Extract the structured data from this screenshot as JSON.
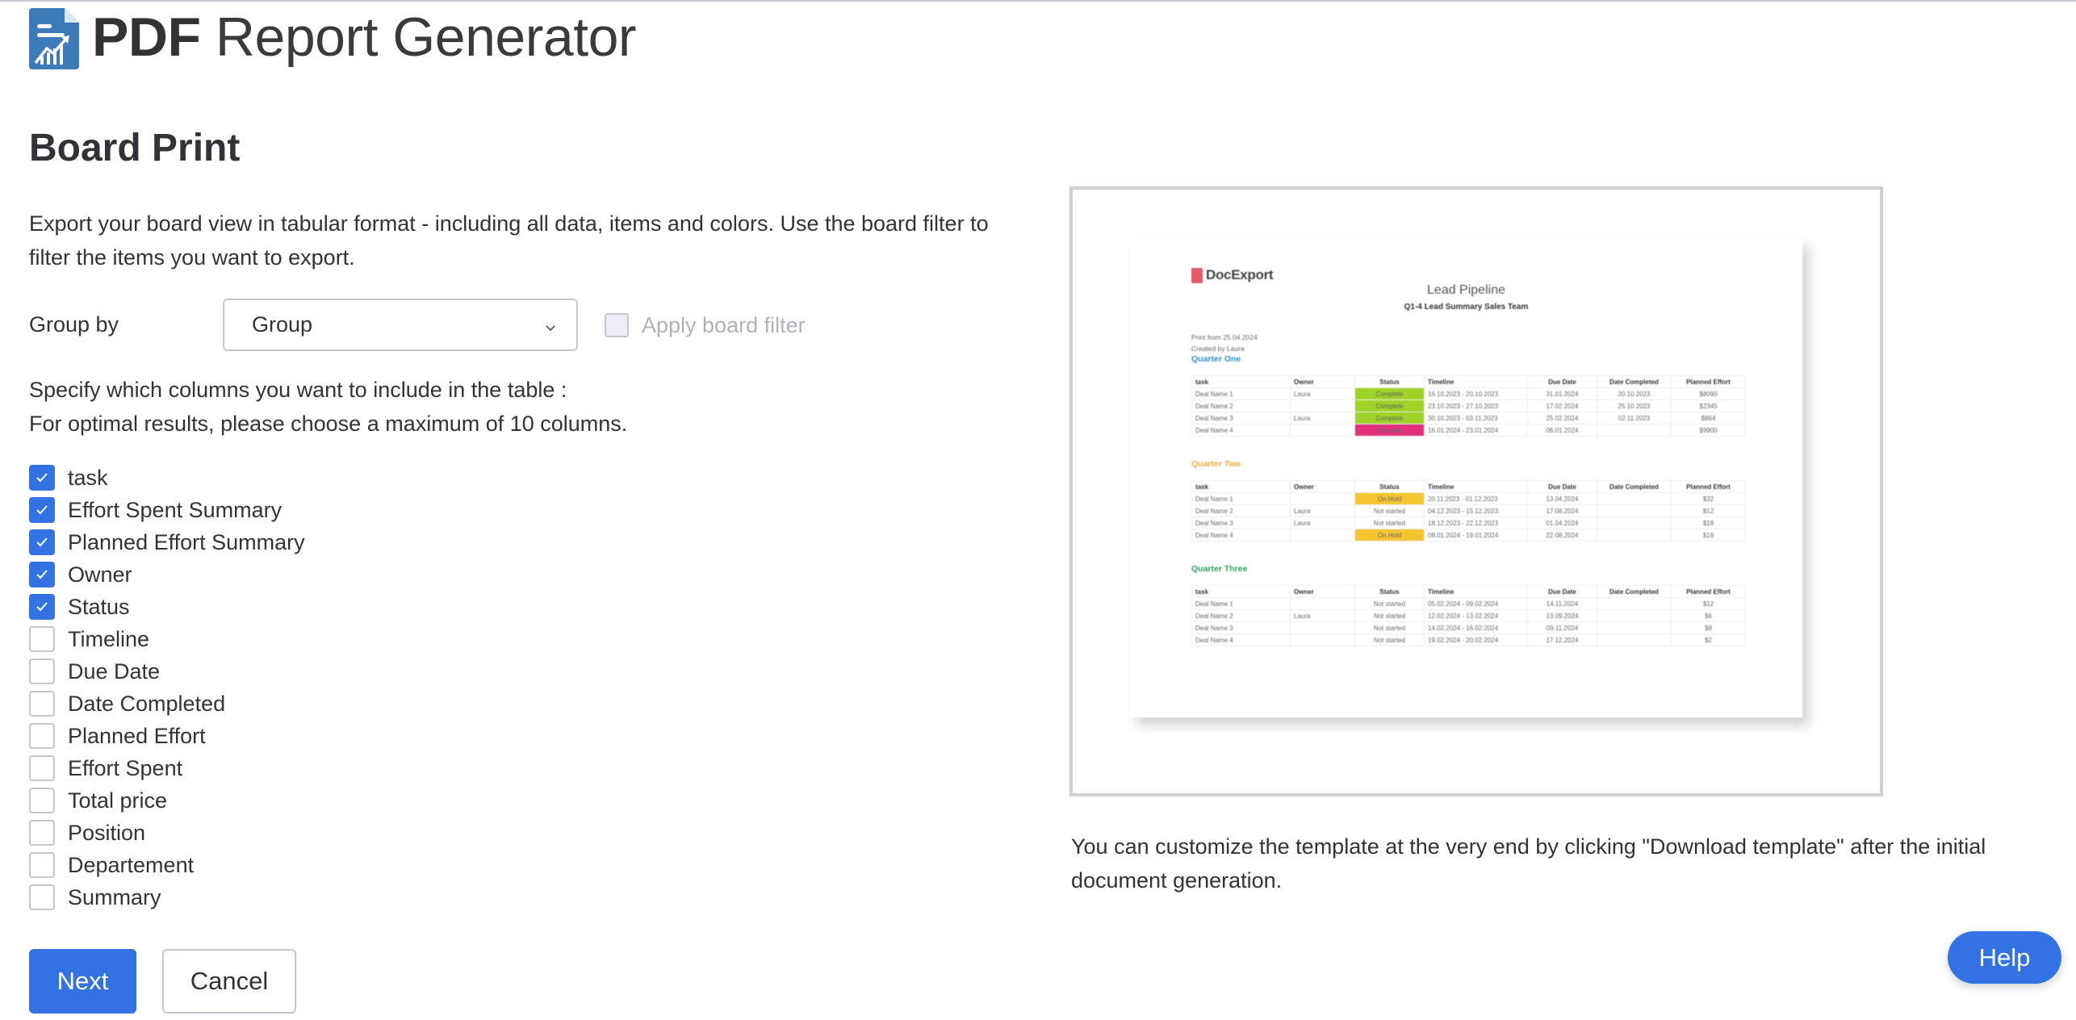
{
  "header": {
    "logo_icon": "report-chart-document-icon",
    "title_bold": "PDF",
    "title_light": "Report Generator"
  },
  "page": {
    "title": "Board Print",
    "description": "Export your board view in tabular format - including all data, items and colors. Use the board filter to filter the items you want to export."
  },
  "group_by": {
    "label": "Group by",
    "selected": "Group",
    "chevron_icon": "chevron-down-icon"
  },
  "apply_filter": {
    "label": "Apply board filter",
    "checked": false,
    "disabled": true
  },
  "columns_help": {
    "line1": "Specify which columns you want to include in the table :",
    "line2": "For optimal results, please choose a maximum of 10 columns."
  },
  "columns": [
    {
      "label": "task",
      "checked": true
    },
    {
      "label": "Effort Spent Summary",
      "checked": true
    },
    {
      "label": "Planned Effort Summary",
      "checked": true
    },
    {
      "label": "Owner",
      "checked": true
    },
    {
      "label": "Status",
      "checked": true
    },
    {
      "label": "Timeline",
      "checked": false
    },
    {
      "label": "Due Date",
      "checked": false
    },
    {
      "label": "Date Completed",
      "checked": false
    },
    {
      "label": "Planned Effort",
      "checked": false
    },
    {
      "label": "Effort Spent",
      "checked": false
    },
    {
      "label": "Total price",
      "checked": false
    },
    {
      "label": "Position",
      "checked": false
    },
    {
      "label": "Departement",
      "checked": false
    },
    {
      "label": "Summary",
      "checked": false
    }
  ],
  "buttons": {
    "next": "Next",
    "cancel": "Cancel",
    "help": "Help"
  },
  "colors": {
    "primary": "#3372e2",
    "complete": "#9cd326",
    "overdue": "#e2307b",
    "on_hold": "#f5c531",
    "quarter_one": "#2b8fd6",
    "quarter_two": "#f7a93b",
    "quarter_three": "#2e9e5b"
  },
  "preview": {
    "brand": "DocExport",
    "title": "Lead Pipeline",
    "subtitle": "Q1-4 Lead Summary Sales Team",
    "print_from": "Print from 25.04.2024",
    "created_by": "Created by Laura",
    "headers": [
      "task",
      "Owner",
      "Status",
      "Timeline",
      "Due Date",
      "Date Completed",
      "Planned Effort"
    ],
    "groups": [
      {
        "name": "Quarter One",
        "color_key": "quarter_one",
        "rows": [
          {
            "task": "Deal Name 1",
            "owner": "Laura",
            "status": "Complete",
            "status_key": "complete",
            "timeline": "16.10.2023 - 20.10.2023",
            "due": "31.01.2024",
            "completed": "20.10.2023",
            "effort": "$8090"
          },
          {
            "task": "Deal Name 2",
            "owner": "",
            "status": "Complete",
            "status_key": "complete",
            "timeline": "23.10.2023 - 27.10.2023",
            "due": "17.02.2024",
            "completed": "25.10.2023",
            "effort": "$2345"
          },
          {
            "task": "Deal Name 3",
            "owner": "Laura",
            "status": "Complete",
            "status_key": "complete",
            "timeline": "30.10.2023 - 03.11.2023",
            "due": "25.02.2024",
            "completed": "02.11.2023",
            "effort": "$864"
          },
          {
            "task": "Deal Name 4",
            "owner": "",
            "status": "Overdue",
            "status_key": "overdue",
            "timeline": "16.01.2024 - 23.01.2024",
            "due": "06.01.2024",
            "completed": "",
            "effort": "$9900"
          }
        ]
      },
      {
        "name": "Quarter Two",
        "color_key": "quarter_two",
        "rows": [
          {
            "task": "Deal Name 1",
            "owner": "",
            "status": "On Hold",
            "status_key": "on_hold",
            "timeline": "20.11.2023 - 01.12.2023",
            "due": "13.04.2024",
            "completed": "",
            "effort": "$32"
          },
          {
            "task": "Deal Name 2",
            "owner": "Laura",
            "status": "Not started",
            "status_key": "",
            "timeline": "04.12.2023 - 15.12.2023",
            "due": "17.08.2024",
            "completed": "",
            "effort": "$12"
          },
          {
            "task": "Deal Name 3",
            "owner": "Laura",
            "status": "Not started",
            "status_key": "",
            "timeline": "18.12.2023 - 22.12.2023",
            "due": "01.04.2024",
            "completed": "",
            "effort": "$18"
          },
          {
            "task": "Deal Name 4",
            "owner": "",
            "status": "On Hold",
            "status_key": "on_hold",
            "timeline": "08.01.2024 - 19.01.2024",
            "due": "22.08.2024",
            "completed": "",
            "effort": "$16"
          }
        ]
      },
      {
        "name": "Quarter Three",
        "color_key": "quarter_three",
        "rows": [
          {
            "task": "Deal Name 1",
            "owner": "",
            "status": "Not started",
            "status_key": "",
            "timeline": "05.02.2024 - 09.02.2024",
            "due": "14.11.2024",
            "completed": "",
            "effort": "$12"
          },
          {
            "task": "Deal Name 2",
            "owner": "Laura",
            "status": "Not started",
            "status_key": "",
            "timeline": "12.02.2024 - 13.02.2024",
            "due": "13.09.2024",
            "completed": "",
            "effort": "$6"
          },
          {
            "task": "Deal Name 3",
            "owner": "",
            "status": "Not started",
            "status_key": "",
            "timeline": "14.02.2024 - 16.02.2024",
            "due": "09.11.2024",
            "completed": "",
            "effort": "$8"
          },
          {
            "task": "Deal Name 4",
            "owner": "",
            "status": "Not started",
            "status_key": "",
            "timeline": "19.02.2024 - 20.02.2024",
            "due": "17.12.2024",
            "completed": "",
            "effort": "$2"
          }
        ]
      }
    ]
  },
  "footer_note": "You can customize the template at the very end by clicking \"Download template\" after the initial document generation."
}
